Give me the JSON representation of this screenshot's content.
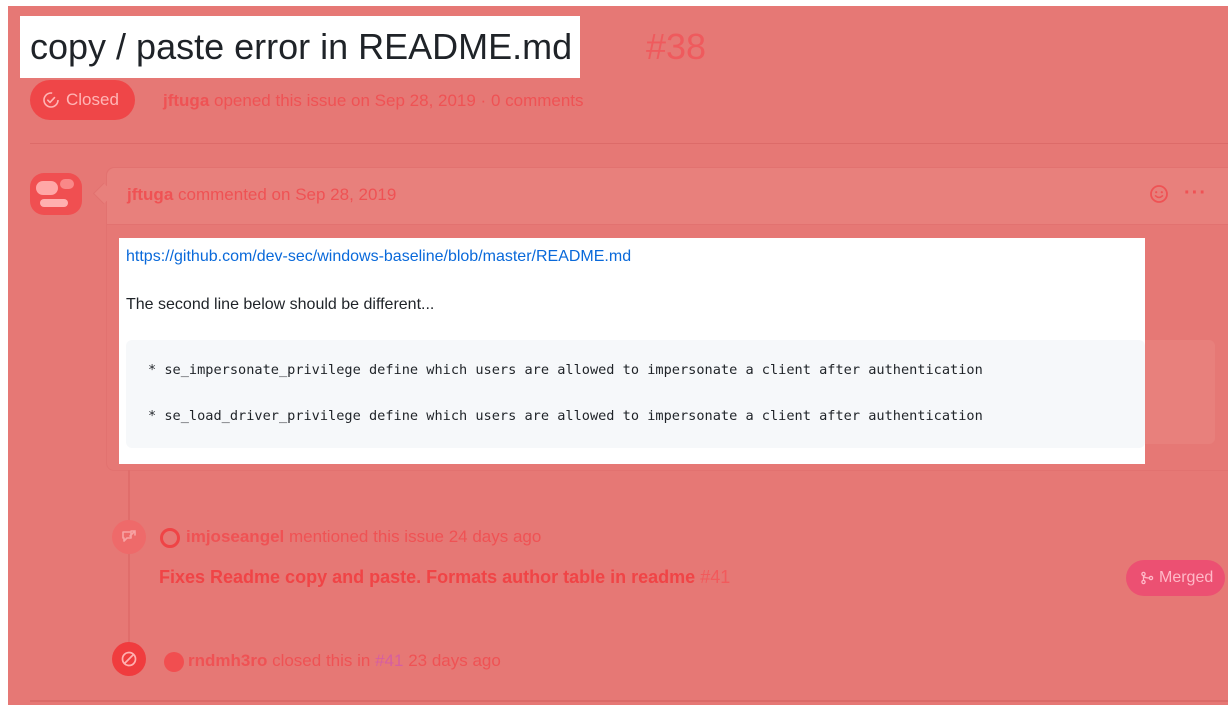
{
  "issue": {
    "title": "copy / paste error in README.md",
    "number": "#38",
    "status": "Closed",
    "author": "jftuga",
    "opened_text": "opened this issue on Sep 28, 2019 · 0 comments"
  },
  "comment": {
    "author": "jftuga",
    "date_text": "commented on Sep 28, 2019",
    "link": "https://github.com/dev-sec/windows-baseline/blob/master/README.md",
    "paragraph": "The second line below should be different...",
    "code_lines": [
      "* se_impersonate_privilege define which users are allowed to impersonate a client after authentication",
      "* se_load_driver_privilege define which users are allowed to impersonate a client after authentication"
    ],
    "more_label": "···"
  },
  "timeline": {
    "mention": {
      "user": "imjoseangel",
      "text": "mentioned this issue 24 days ago",
      "pr_title": "Fixes Readme copy and paste. Formats author table in readme",
      "pr_number": "#41",
      "pr_status": "Merged"
    },
    "closed": {
      "user": "rndmh3ro",
      "text_before": "closed this in",
      "ref": "#41",
      "text_after": "23 days ago"
    }
  },
  "colors": {
    "overlay": "#e67875",
    "closed_badge": "#ef4648",
    "merged_badge": "#ec5072",
    "link": "#0969da"
  },
  "icons": [
    "issue-closed-icon",
    "smiley-icon",
    "kebab-icon",
    "cross-reference-icon",
    "circle-slash-icon",
    "git-merge-icon"
  ]
}
